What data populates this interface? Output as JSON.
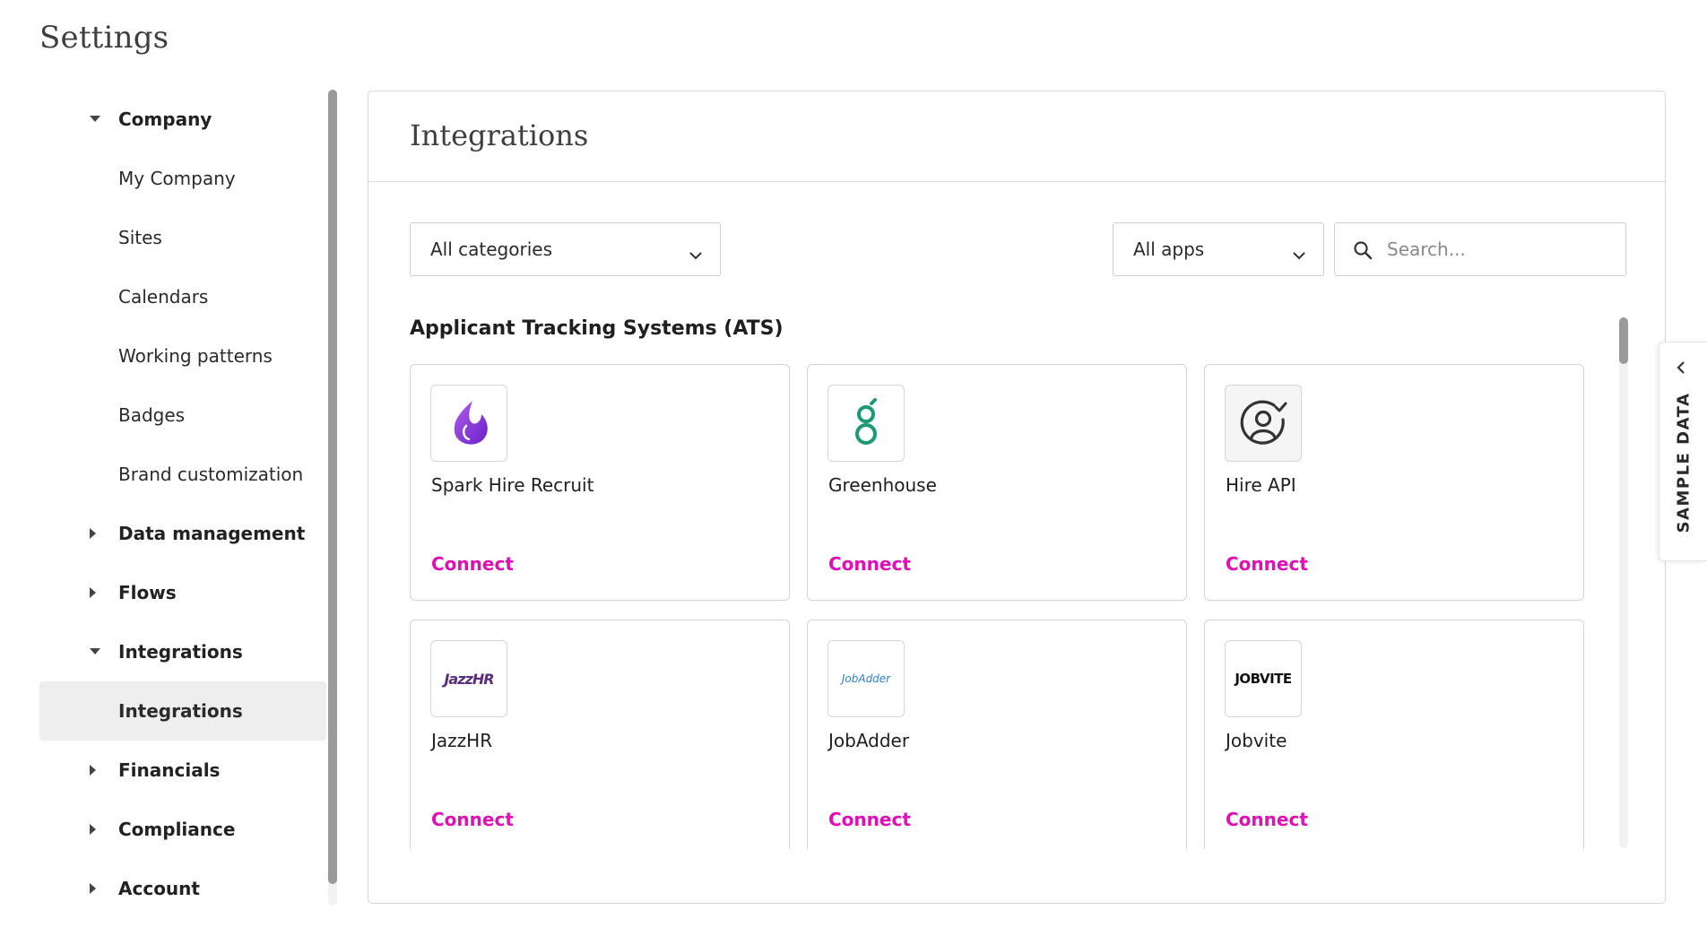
{
  "page": {
    "title": "Settings"
  },
  "sidebar": {
    "items": [
      {
        "label": "Company",
        "type": "parent",
        "caret": "caret-down-icon"
      },
      {
        "label": "My Company",
        "type": "child"
      },
      {
        "label": "Sites",
        "type": "child"
      },
      {
        "label": "Calendars",
        "type": "child"
      },
      {
        "label": "Working patterns",
        "type": "child"
      },
      {
        "label": "Badges",
        "type": "child"
      },
      {
        "label": "Brand customization",
        "type": "child"
      },
      {
        "label": "Data management",
        "type": "parent",
        "caret": "caret-right-icon"
      },
      {
        "label": "Flows",
        "type": "parent",
        "caret": "caret-right-icon"
      },
      {
        "label": "Integrations",
        "type": "parent",
        "caret": "caret-down-icon"
      },
      {
        "label": "Integrations",
        "type": "child",
        "active": true
      },
      {
        "label": "Financials",
        "type": "parent",
        "caret": "caret-right-icon"
      },
      {
        "label": "Compliance",
        "type": "parent",
        "caret": "caret-right-icon"
      },
      {
        "label": "Account",
        "type": "parent",
        "caret": "caret-right-icon"
      }
    ]
  },
  "main": {
    "title": "Integrations",
    "filters": {
      "category": "All categories",
      "apps": "All apps",
      "search_placeholder": "Search..."
    },
    "section_title": "Applicant Tracking Systems (ATS)",
    "cards": [
      {
        "name": "Spark Hire Recruit",
        "action": "Connect",
        "logo": "spark-hire-logo"
      },
      {
        "name": "Greenhouse",
        "action": "Connect",
        "logo": "greenhouse-logo"
      },
      {
        "name": "Hire API",
        "action": "Connect",
        "logo": "hire-api-logo"
      },
      {
        "name": "JazzHR",
        "action": "Connect",
        "logo": "jazzhr-logo",
        "logo_text": "JazzHR"
      },
      {
        "name": "JobAdder",
        "action": "Connect",
        "logo": "jobadder-logo",
        "logo_text": "JobAdder"
      },
      {
        "name": "Jobvite",
        "action": "Connect",
        "logo": "jobvite-logo",
        "logo_text": "JOBVITE"
      }
    ]
  },
  "sample_tab": {
    "label": "SAMPLE DATA"
  },
  "colors": {
    "accent": "#e10fb5",
    "active_bg": "#eeeeee",
    "border": "#d4d4d4"
  }
}
